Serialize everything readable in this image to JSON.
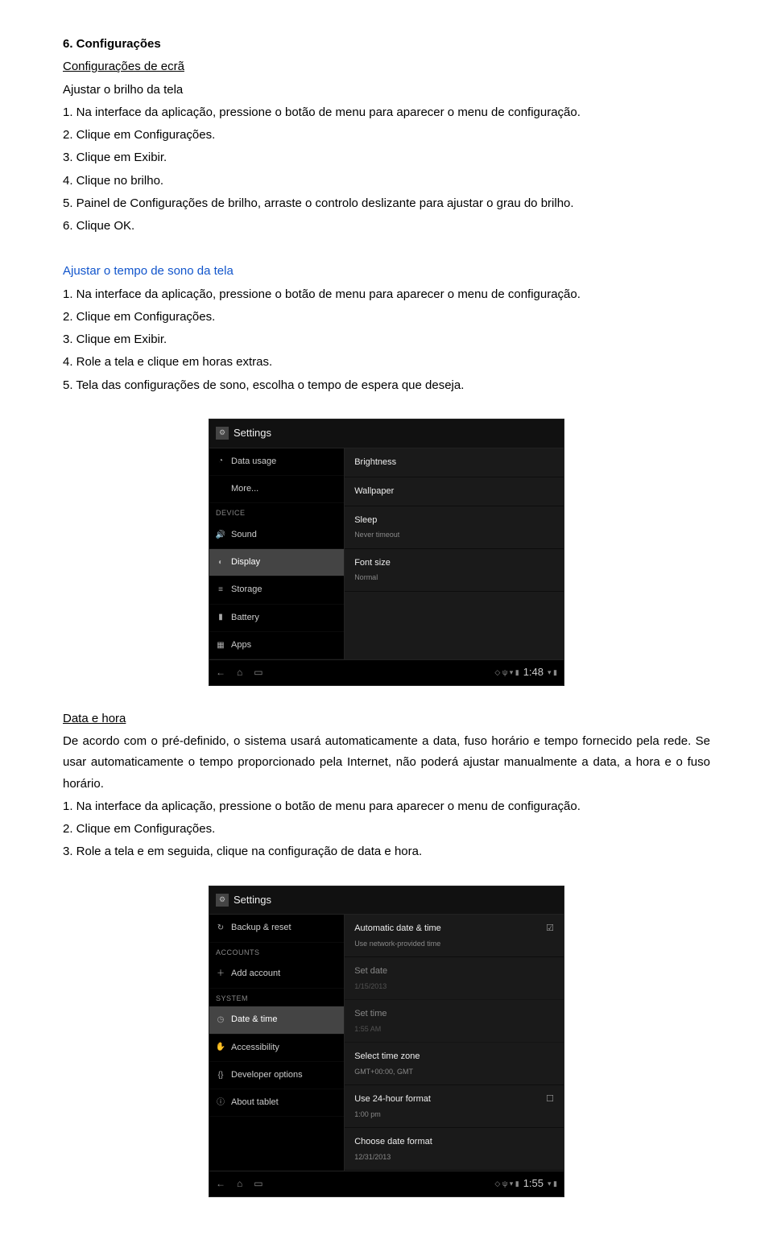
{
  "h1": "6. Configurações",
  "sec1": {
    "title": "Configurações de ecrã",
    "subtitle": "Ajustar o brilho da tela",
    "s1": "1. Na interface da aplicação, pressione o botão de menu para aparecer o menu de configuração.",
    "s2": "2. Clique em Configurações.",
    "s3": "3. Clique em Exibir.",
    "s4": "4. Clique no brilho.",
    "s5": "5. Painel de Configurações de brilho, arraste o controlo deslizante para ajustar o grau do brilho.",
    "s6": "6. Clique OK."
  },
  "sec2": {
    "title": "Ajustar o tempo de sono da tela",
    "s1": "1. Na interface da aplicação, pressione o botão de menu para aparecer o menu de configuração.",
    "s2": "2. Clique em Configurações.",
    "s3": "3. Clique em Exibir.",
    "s4": "4. Role a tela e clique em horas extras.",
    "s5": "5. Tela das configurações de sono, escolha o tempo de espera que deseja."
  },
  "shot1": {
    "title": "Settings",
    "left": {
      "data": "Data usage",
      "more": "More...",
      "cat": "DEVICE",
      "sound": "Sound",
      "display": "Display",
      "storage": "Storage",
      "battery": "Battery",
      "apps": "Apps"
    },
    "right": {
      "r1": "Brightness",
      "r2": "Wallpaper",
      "r3": "Sleep",
      "r3s": "Never timeout",
      "r4": "Font size",
      "r4s": "Normal"
    },
    "time": "1:48"
  },
  "sec3": {
    "title": "Data e hora",
    "p1": "De acordo com o pré-definido, o sistema usará automaticamente a data, fuso horário e tempo fornecido pela rede. Se usar automaticamente o tempo proporcionado pela Internet, não poderá ajustar manualmente a data, a hora e o fuso horário.",
    "s1": "1. Na interface da aplicação, pressione o botão de menu para aparecer o menu de configuração.",
    "s2": "2. Clique em Configurações.",
    "s3": "3. Role a tela e em seguida, clique na configuração de data e hora."
  },
  "shot2": {
    "title": "Settings",
    "left": {
      "backup": "Backup & reset",
      "cat1": "ACCOUNTS",
      "add": "Add account",
      "cat2": "SYSTEM",
      "date": "Date & time",
      "access": "Accessibility",
      "dev": "Developer options",
      "about": "About tablet"
    },
    "right": {
      "r1": "Automatic date & time",
      "r1s": "Use network-provided time",
      "r2": "Set date",
      "r2s": "1/15/2013",
      "r3": "Set time",
      "r3s": "1:55 AM",
      "r4": "Select time zone",
      "r4s": "GMT+00:00, GMT",
      "r5": "Use 24-hour format",
      "r5s": "1:00 pm",
      "r6": "Choose date format",
      "r6s": "12/31/2013"
    },
    "time": "1:55"
  }
}
